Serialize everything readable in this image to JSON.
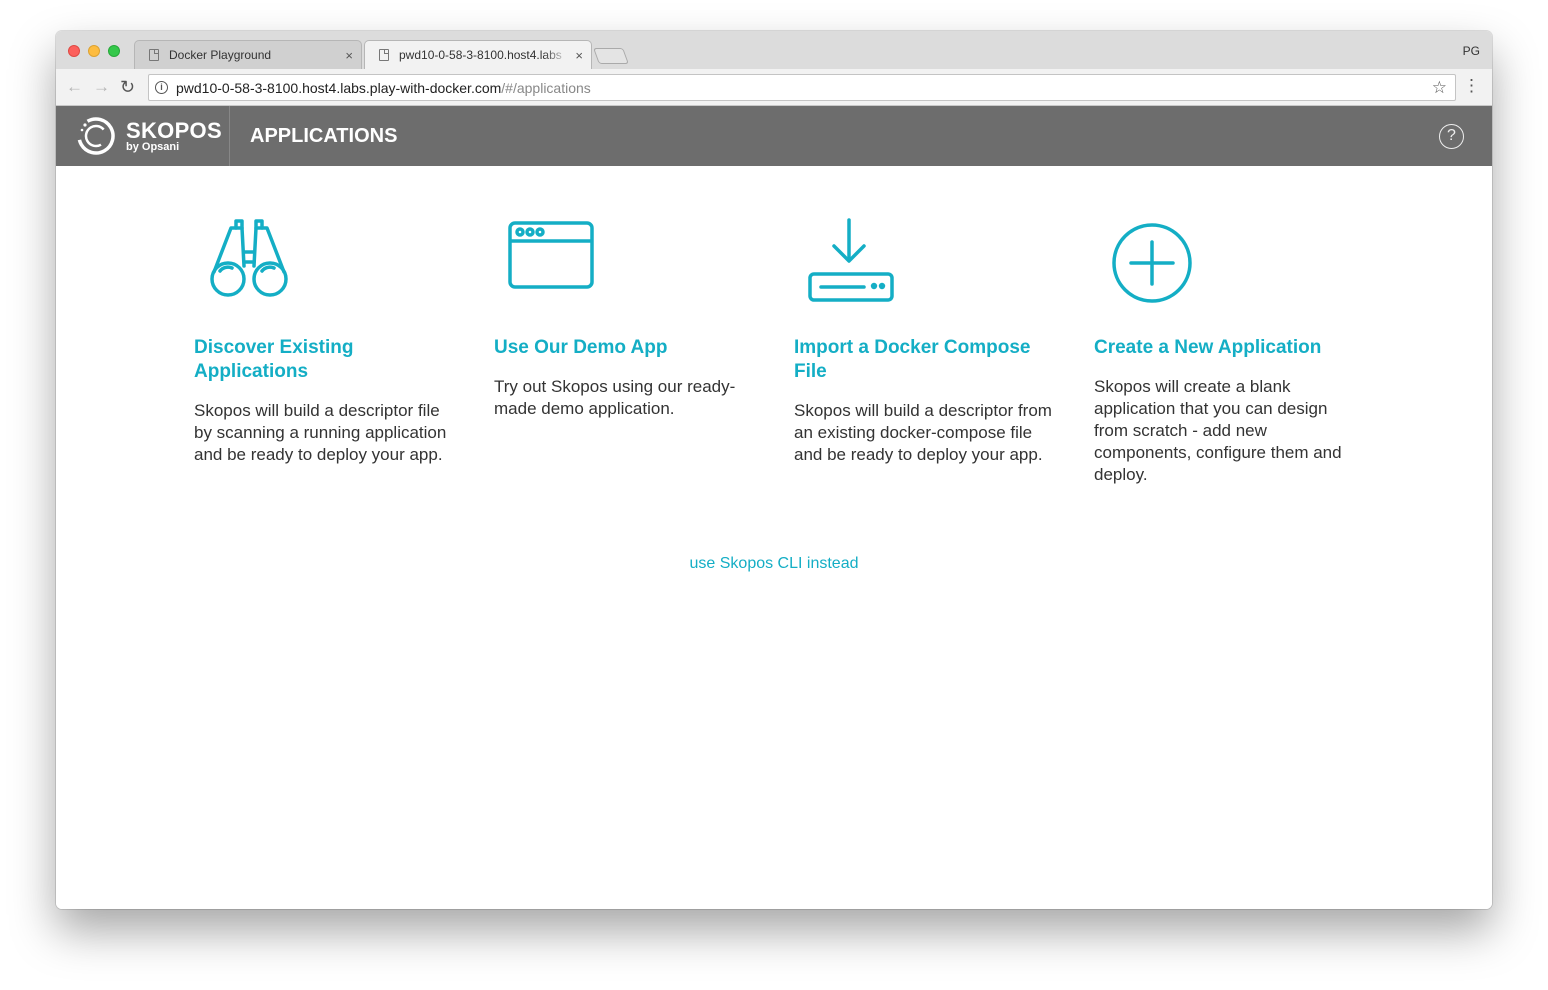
{
  "browser": {
    "tabs": [
      {
        "title": "Docker Playground",
        "close": "×"
      },
      {
        "title": "pwd10-0-58-3-8100.host4.labs",
        "close": "×"
      }
    ],
    "profile": "PG",
    "url_host": "pwd10-0-58-3-8100.host4.labs.play-with-docker.com",
    "url_path": "/#/applications",
    "back_glyph": "←",
    "forward_glyph": "→",
    "reload_glyph": "↻",
    "star_glyph": "☆",
    "menu_glyph": "⋮",
    "info_glyph": "i"
  },
  "header": {
    "brand_name": "SKOPOS",
    "brand_sub": "by Opsani",
    "title": "APPLICATIONS",
    "help_glyph": "?"
  },
  "accent_color": "#14aec5",
  "cards": [
    {
      "icon": "binoculars-icon",
      "title": "Discover Existing Applications",
      "description": "Skopos will build a descriptor file by scanning a running application and be ready to deploy your app."
    },
    {
      "icon": "browser-window-icon",
      "title": "Use Our Demo App",
      "description": "Try out Skopos using our ready-made demo application."
    },
    {
      "icon": "download-import-icon",
      "title": "Import a Docker Compose File",
      "description": "Skopos will build a descriptor from an existing docker-compose file and be ready to deploy your app."
    },
    {
      "icon": "plus-circle-icon",
      "title": "Create a New Application",
      "description": "Skopos will create a blank application that you can design from scratch - add new components, configure them and deploy."
    }
  ],
  "cli_link": "use Skopos CLI instead"
}
